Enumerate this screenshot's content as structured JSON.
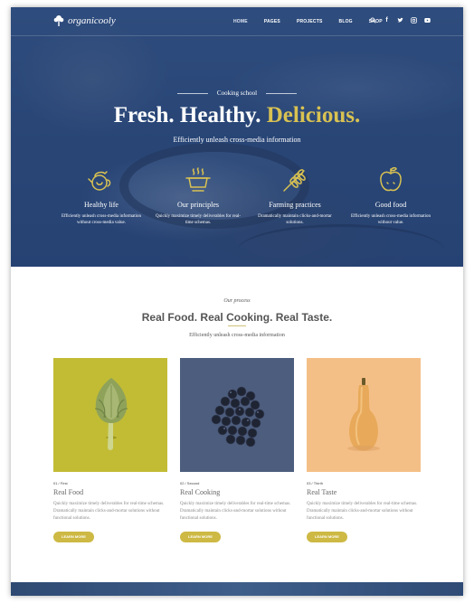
{
  "brand": {
    "name": "organicooly"
  },
  "nav": {
    "items": [
      "HOME",
      "PAGES",
      "PROJECTS",
      "BLOG",
      "SHOP"
    ],
    "active": "HOME",
    "icons": [
      "search-icon",
      "facebook-icon",
      "twitter-icon",
      "instagram-icon",
      "youtube-icon"
    ]
  },
  "hero": {
    "eyebrow": "Cooking school",
    "title_plain": "Fresh. Healthy.",
    "title_accent": "Delicious.",
    "subtitle": "Efficiently unleash cross-media information",
    "accent_color": "#d9c252",
    "features": [
      {
        "icon": "teapot-icon",
        "title": "Healthy life",
        "desc": "Efficiently unleash cross-media information without cross-media value."
      },
      {
        "icon": "cooking-pot-icon",
        "title": "Our principles",
        "desc": "Quickly maximize timely deliverables for real-time schemas."
      },
      {
        "icon": "wheat-icon",
        "title": "Farming practices",
        "desc": "Dramatically maintain clicks-and-mortar solutions."
      },
      {
        "icon": "apple-icon",
        "title": "Good food",
        "desc": "Efficiently unleash cross-media information without value."
      }
    ]
  },
  "process": {
    "eyebrow": "Our process",
    "title": "Real Food. Real Cooking. Real Taste.",
    "subtitle": "Efficiently unleash cross-media information",
    "cards": [
      {
        "tag": "01 / First",
        "title": "Real Food",
        "desc": "Quickly maximize timely deliverables for real-time schemas. Dramatically maintain clicks-and-mortar solutions without functional solutions.",
        "button": "LEARN MORE",
        "image": "artichoke",
        "bg": "#c2bc35"
      },
      {
        "tag": "02 / Second",
        "title": "Real Cooking",
        "desc": "Quickly maximize timely deliverables for real-time schemas. Dramatically maintain clicks-and-mortar solutions without functional solutions.",
        "button": "LEARN MORE",
        "image": "blueberries",
        "bg": "#4d5d7d"
      },
      {
        "tag": "03 / Thirth",
        "title": "Real Taste",
        "desc": "Quickly maximize timely deliverables for real-time schemas. Dramatically maintain clicks-and-mortar solutions without functional solutions.",
        "button": "LEARN MORE",
        "image": "butternut-squash",
        "bg": "#f4bf86"
      }
    ],
    "button_color": "#cdb944"
  }
}
